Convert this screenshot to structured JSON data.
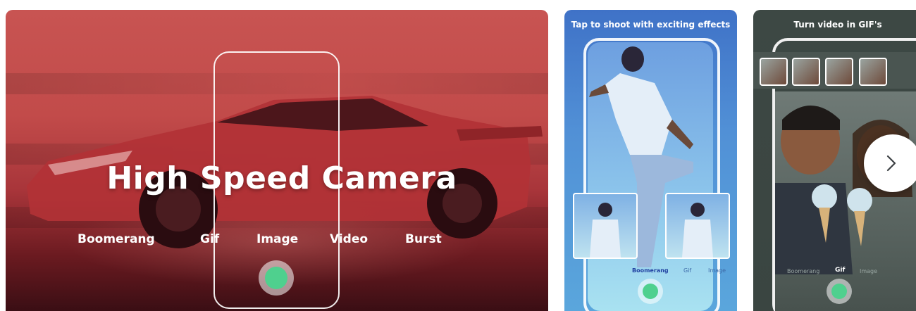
{
  "main_card": {
    "title": "High Speed Camera",
    "modes": [
      "Boomerang",
      "Gif",
      "Image",
      "Video",
      "Burst"
    ]
  },
  "blue_card": {
    "caption": "Tap to shoot with exciting effects",
    "modes": [
      "Boomerang",
      "Gif",
      "Image"
    ],
    "active_mode": "Boomerang"
  },
  "dark_card": {
    "caption": "Turn video in GIF's",
    "modes": [
      "Boomerang",
      "Gif",
      "Image"
    ],
    "active_mode": "Gif"
  },
  "colors": {
    "shutter": "#4fd08e",
    "main_bg": "#c24b4a",
    "blue_bg": "#5190d6",
    "dark_bg": "#3d4844"
  },
  "icons": {
    "next": "chevron-right-icon"
  }
}
